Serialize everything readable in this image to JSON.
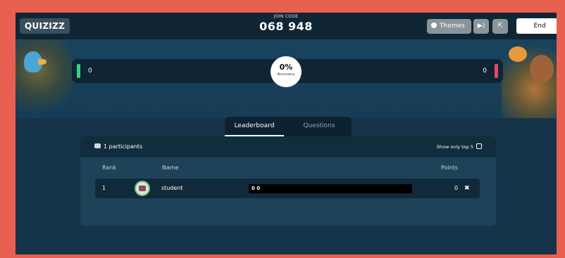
{
  "topbar": {
    "logo": "QUIZIZZ",
    "join_label": "JOIN CODE",
    "join_code": "068 948",
    "themes_label": "Themes",
    "sound_icon": "volume-icon",
    "fullscreen_icon": "fullscreen-icon",
    "end_label": "End"
  },
  "accuracy": {
    "correct_count": "0",
    "incorrect_count": "0",
    "percent": "0%",
    "label": "Accuracy"
  },
  "tabs": [
    {
      "label": "Leaderboard",
      "active": true
    },
    {
      "label": "Questions",
      "active": false
    }
  ],
  "leaderboard": {
    "participants": "1 participants",
    "show_top": "Show only top 5",
    "columns": {
      "rank": "Rank",
      "name": "Name",
      "points": "Points"
    },
    "rows": [
      {
        "rank": "1",
        "name": "student",
        "progress": "0 0",
        "points": "0",
        "remove_icon": "close-icon"
      }
    ]
  },
  "colors": {
    "frame": "#e8604f",
    "correct": "#3ecf7a",
    "incorrect": "#e24a6a",
    "topbar": "#102634"
  }
}
